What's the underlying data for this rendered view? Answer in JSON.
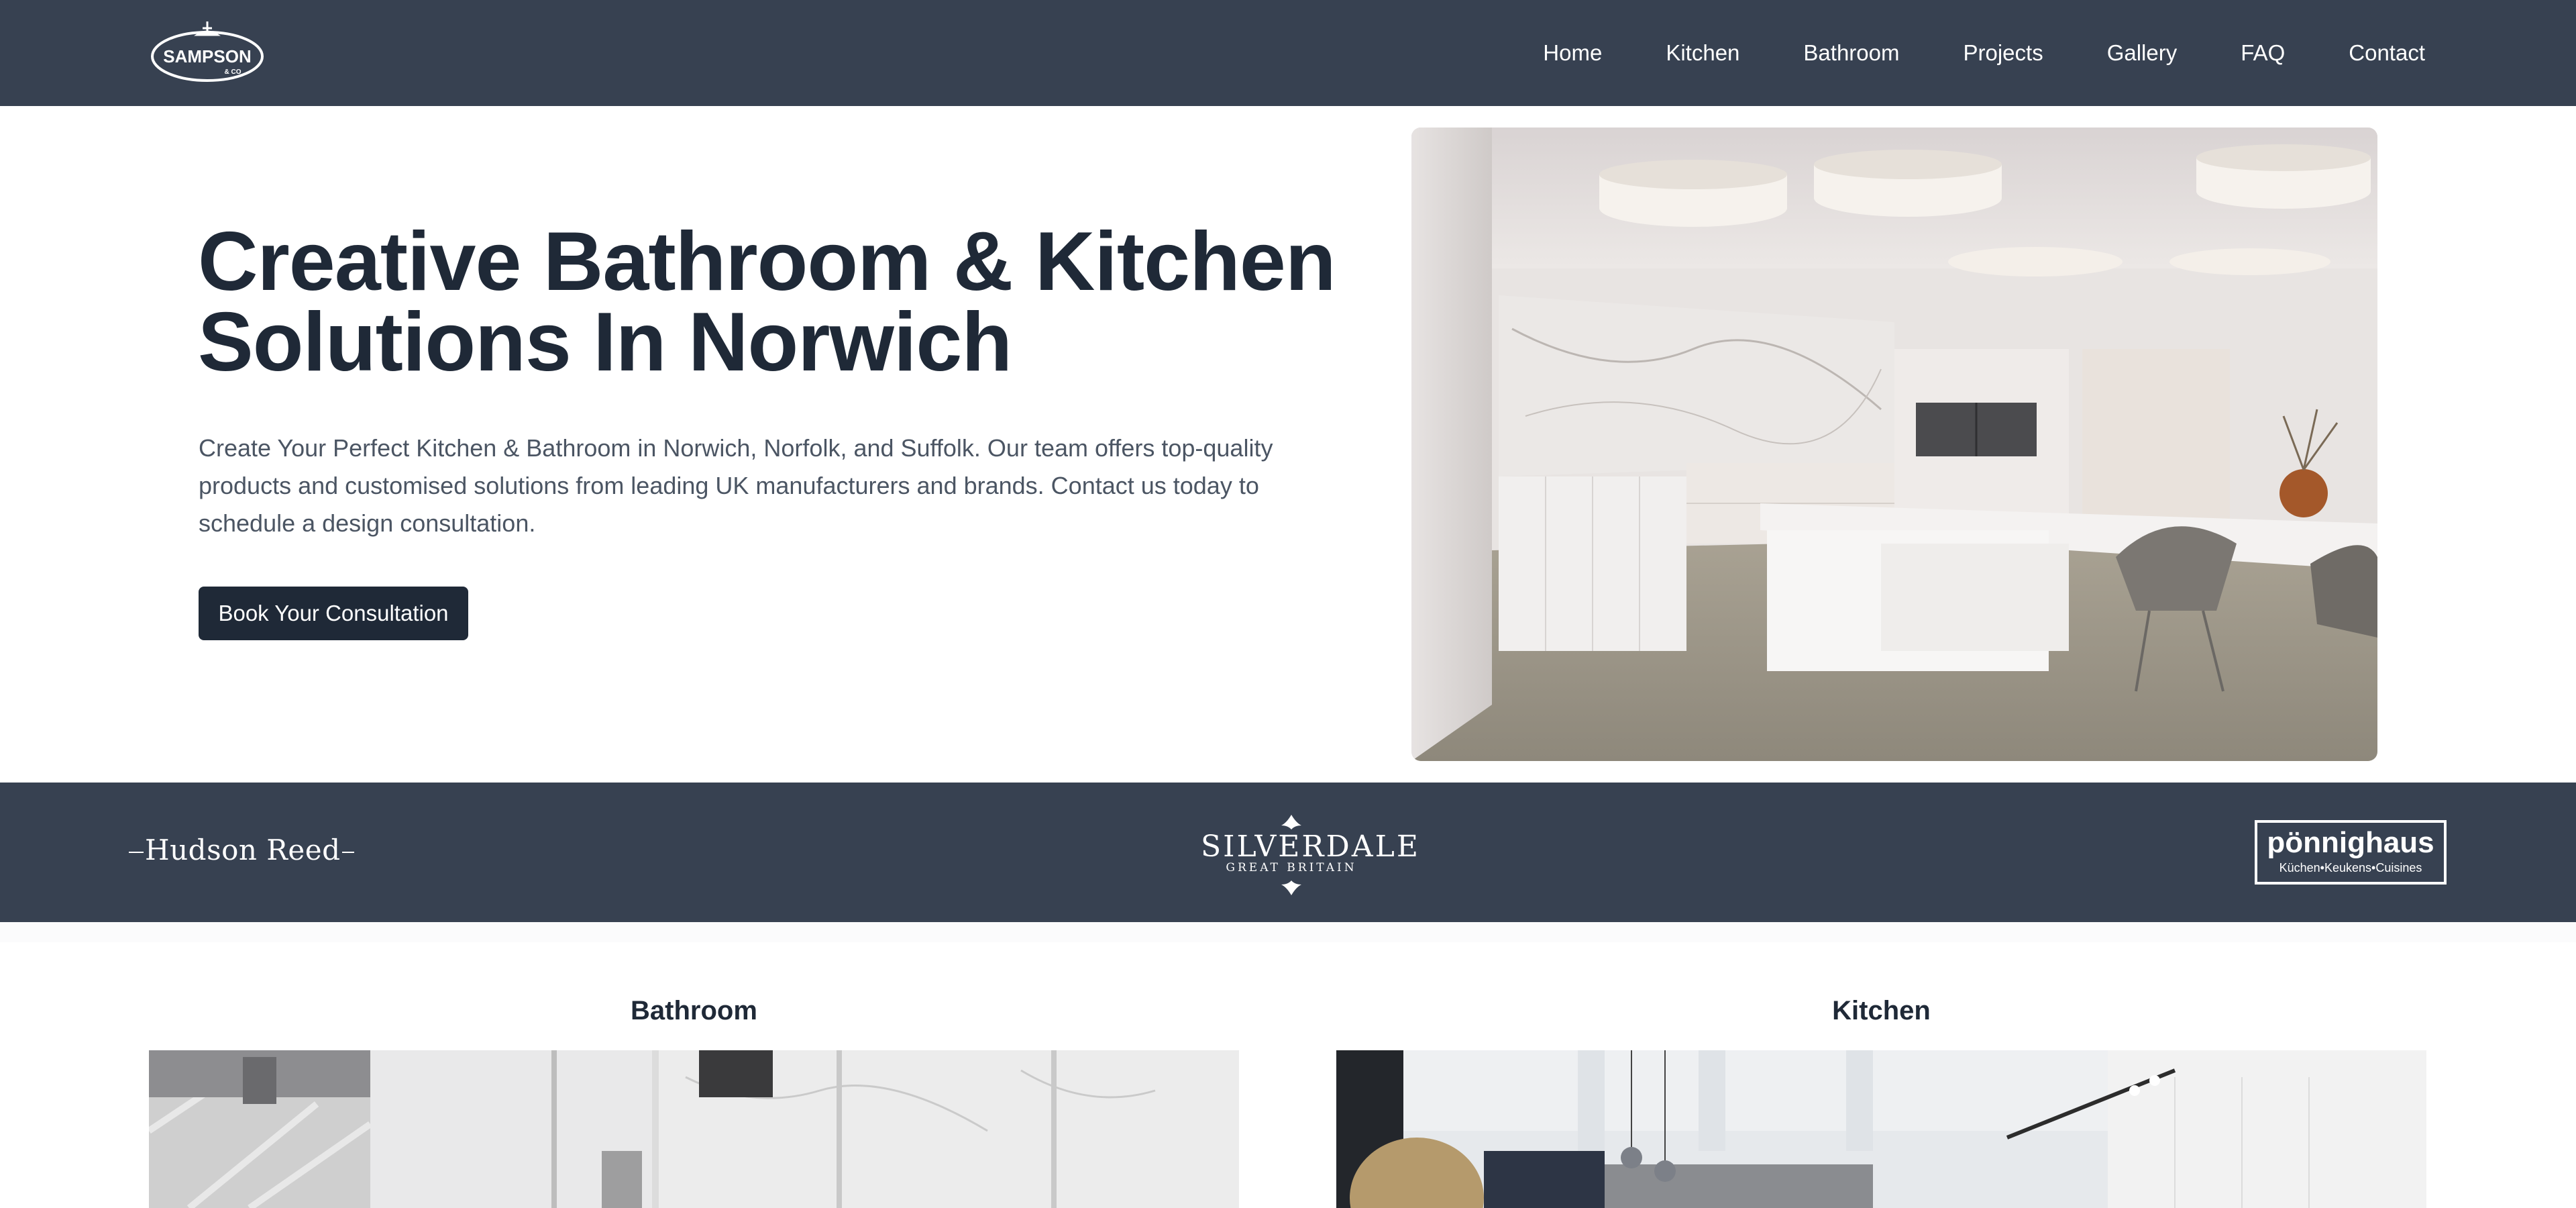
{
  "nav": {
    "logo": {
      "text": "SAMPSON",
      "subtext": "& CO"
    },
    "links": [
      "Home",
      "Kitchen",
      "Bathroom",
      "Projects",
      "Gallery",
      "FAQ",
      "Contact"
    ]
  },
  "hero": {
    "title_lines": [
      "Creative Bathroom & Kitchen",
      "Solutions In Norwich"
    ],
    "description_lines": [
      "Create Your Perfect Kitchen & Bathroom in Norwich, Norfolk, and Suffolk. Our team offers top-quality",
      "products and customised solutions from leading UK manufacturers and brands. Contact us today to",
      "schedule a design consultation."
    ],
    "cta_label": "Book Your Consultation"
  },
  "brands": {
    "hudson_reed": "Hudson Reed",
    "silverdale": {
      "name": "SILVERDALE",
      "sub": "GREAT BRITAIN"
    },
    "ponnighaus": {
      "name": "pönnighaus",
      "sub": "Küchen•Keukens•Cuisines"
    }
  },
  "categories": [
    {
      "title": "Bathroom"
    },
    {
      "title": "Kitchen"
    }
  ],
  "colors": {
    "nav_bg": "#374151",
    "heading": "#1f2937",
    "body_text": "#4b5563",
    "button_bg": "#1f2937",
    "button_text": "#ffffff"
  }
}
